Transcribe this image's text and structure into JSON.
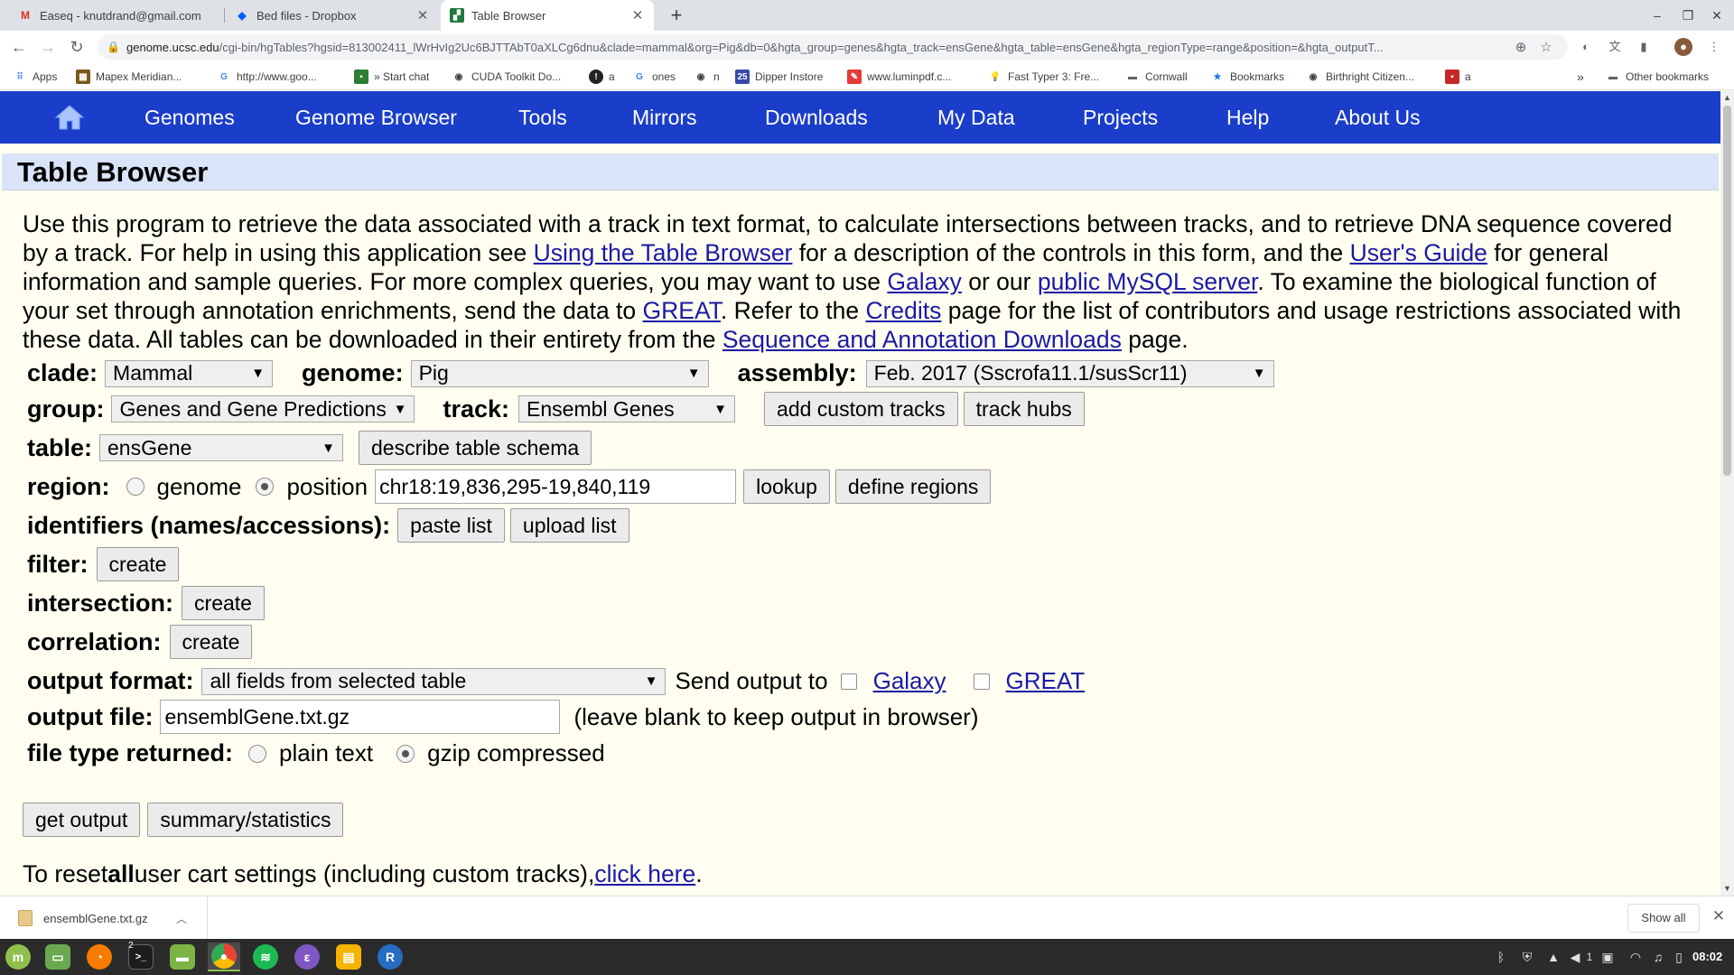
{
  "browser": {
    "tabs": [
      {
        "title": "Easeq - knutdrand@gmail.com",
        "icon": "gmail-icon"
      },
      {
        "title": "Bed files - Dropbox",
        "icon": "dropbox-icon"
      },
      {
        "title": "Table Browser",
        "icon": "ucsc-icon"
      }
    ],
    "url_host": "genome.ucsc.edu",
    "url_rest": "/cgi-bin/hgTables?hgsid=813002411_lWrHvIg2Uc6BJTTAbT0aXLCg6dnu&clade=mammal&org=Pig&db=0&hgta_group=genes&hgta_track=ensGene&hgta_table=ensGene&hgta_regionType=range&position=&hgta_outputT...",
    "bookmarks": [
      {
        "label": "Apps",
        "icon": "apps-icon"
      },
      {
        "label": "Mapex Meridian...",
        "icon": "mapex-icon"
      },
      {
        "label": "http://www.goo...",
        "icon": "google-icon"
      },
      {
        "label": "» Start chat",
        "icon": "chat-icon"
      },
      {
        "label": "CUDA Toolkit Do...",
        "icon": "globe-icon"
      },
      {
        "label": "a",
        "icon": "a-icon"
      },
      {
        "label": "ones",
        "icon": "google-icon"
      },
      {
        "label": "n",
        "icon": "globe-icon"
      },
      {
        "label": "Dipper Instore",
        "icon": "calendar-icon"
      },
      {
        "label": "www.luminpdf.c...",
        "icon": "pdf-icon"
      },
      {
        "label": "Fast Typer 3: Fre...",
        "icon": "bulb-icon"
      },
      {
        "label": "Cornwall",
        "icon": "folder-icon"
      },
      {
        "label": "Bookmarks",
        "icon": "star-icon"
      },
      {
        "label": "Birthright Citizen...",
        "icon": "globe-icon"
      },
      {
        "label": "a",
        "icon": "red-icon"
      }
    ],
    "bookmarks_more": "»",
    "other_bookmarks": "Other bookmarks"
  },
  "nav": {
    "items": [
      "Genomes",
      "Genome Browser",
      "Tools",
      "Mirrors",
      "Downloads",
      "My Data",
      "Projects",
      "Help",
      "About Us"
    ]
  },
  "page": {
    "title": "Table Browser",
    "intro": {
      "t1": "Use this program to retrieve the data associated with a track in text format, to calculate intersections between tracks, and to retrieve DNA sequence covered by a track. For help in using this application see ",
      "l1": "Using the Table Browser",
      "t2": " for a description of the controls in this form, and the ",
      "l2": "User's Guide",
      "t3": " for general information and sample queries. For more complex queries, you may want to use ",
      "l3": "Galaxy",
      "t4": " or our ",
      "l4": "public MySQL server",
      "t5": ". To examine the biological function of your set through annotation enrichments, send the data to ",
      "l5": "GREAT",
      "t6": ". Refer to the ",
      "l6": "Credits",
      "t7": " page for the list of contributors and usage restrictions associated with these data. All tables can be downloaded in their entirety from the ",
      "l7": "Sequence and Annotation Downloads",
      "t8": " page."
    }
  },
  "form": {
    "clade_label": "clade:",
    "clade_value": "Mammal",
    "genome_label": "genome:",
    "genome_value": "Pig",
    "assembly_label": "assembly:",
    "assembly_value": "Feb. 2017 (Sscrofa11.1/susScr11)",
    "group_label": "group:",
    "group_value": "Genes and Gene Predictions",
    "track_label": "track:",
    "track_value": "Ensembl Genes",
    "add_custom_tracks": "add custom tracks",
    "track_hubs": "track hubs",
    "table_label": "table:",
    "table_value": "ensGene",
    "describe_schema": "describe table schema",
    "region_label": "region:",
    "region_genome": "genome",
    "region_position": "position",
    "region_selected": "position",
    "position_value": "chr18:19,836,295-19,840,119",
    "lookup": "lookup",
    "define_regions": "define regions",
    "identifiers_label": "identifiers (names/accessions):",
    "paste_list": "paste list",
    "upload_list": "upload list",
    "filter_label": "filter:",
    "filter_create": "create",
    "intersection_label": "intersection:",
    "intersection_create": "create",
    "correlation_label": "correlation:",
    "correlation_create": "create",
    "output_format_label": "output format:",
    "output_format_value": "all fields from selected table",
    "send_output_to": "Send output to",
    "send_galaxy": "Galaxy",
    "send_great": "GREAT",
    "output_file_label": "output file:",
    "output_file_value": "ensemblGene.txt.gz",
    "output_file_hint": "(leave blank to keep output in browser)",
    "file_type_label": "file type returned:",
    "file_plain": "plain text",
    "file_gzip": "gzip compressed",
    "file_type_selected": "gzip compressed",
    "get_output": "get output",
    "summary_statistics": "summary/statistics",
    "reset_t1": "To reset ",
    "reset_bold": "all",
    "reset_t2": " user cart settings (including custom tracks), ",
    "reset_link": "click here",
    "reset_t3": "."
  },
  "downloads": {
    "filename": "ensemblGene.txt.gz",
    "show_all": "Show all"
  },
  "taskbar": {
    "clock": "08:02",
    "workspace_badge": "2",
    "tray_count": "1"
  },
  "colors": {
    "nav_bg": "#1a3ec9",
    "title_bg": "#d9e4f8",
    "page_bg": "#fffef0",
    "link": "#1a1aa6"
  }
}
